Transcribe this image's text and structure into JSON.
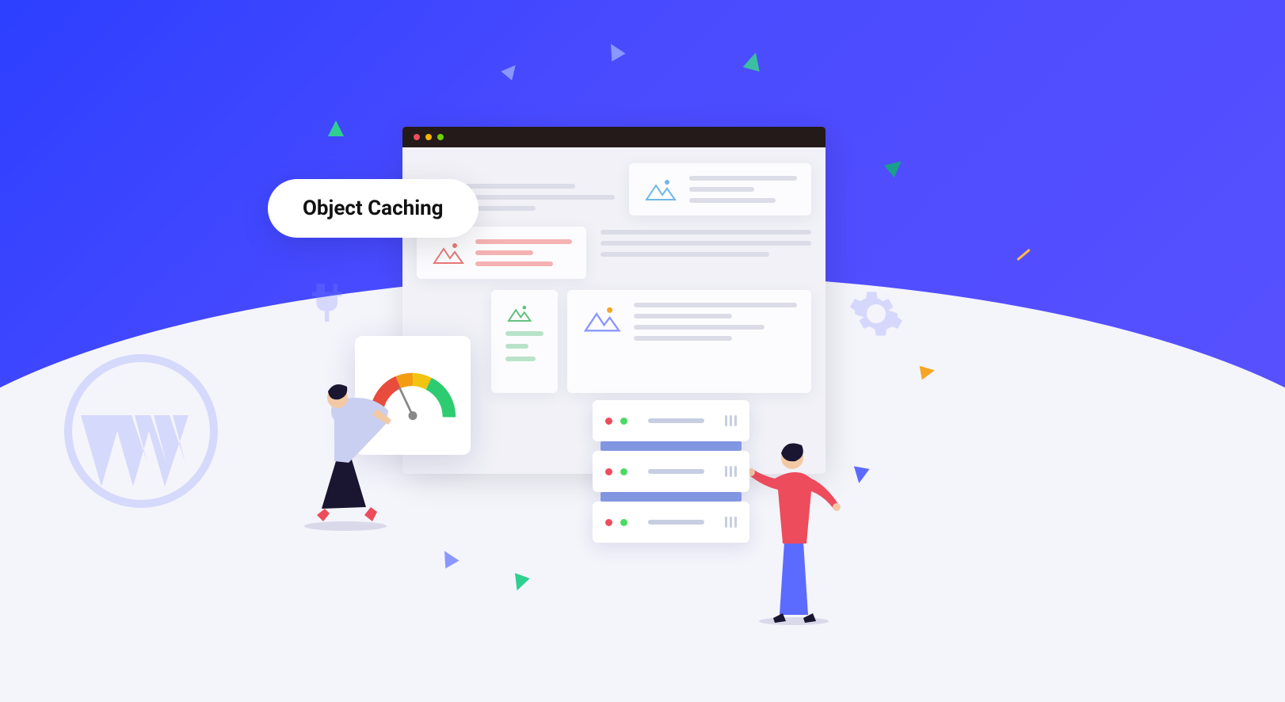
{
  "label": {
    "text": "Object Caching"
  },
  "colors": {
    "bg_gradient_from": "#2d3fff",
    "bg_gradient_to": "#5b52ff",
    "ground": "#f4f4fb",
    "pill_bg": "#ffffff",
    "pill_text": "#111111"
  },
  "browser": {
    "traffic_lights": [
      "red",
      "yellow",
      "green"
    ]
  },
  "server_rows": 3,
  "decorative_icons": [
    "wordpress-logo",
    "plug-icon",
    "gear-icon"
  ],
  "triangles": 10
}
